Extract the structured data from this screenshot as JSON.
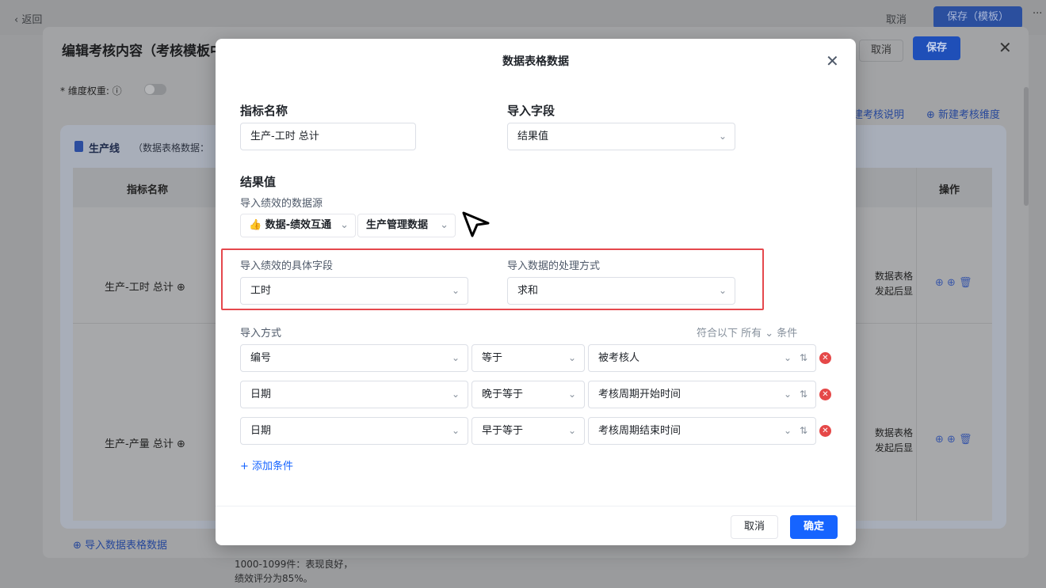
{
  "app": {
    "back": "‹ 返回",
    "top_cancel": "取消",
    "top_save": "保存（模板）",
    "more": "···"
  },
  "editor": {
    "title": "编辑考核内容（考核模板中",
    "cancel": "取消",
    "save": "保存",
    "close": "✕",
    "weight_label": "* 维度权重: ⓘ",
    "link_desc": "建考核说明",
    "link_new_dimension": "⊕ 新建考核维度",
    "section_name": "生产线",
    "section_sub": "（数据表格数据：",
    "col_indicator": "指标名称",
    "col_ops": "操作",
    "rows": [
      {
        "name": "生产-工时 总计 ⊕",
        "cell": [
          "数据表格",
          "发起后显"
        ]
      },
      {
        "name": "生产-产量 总计 ⊕",
        "cell": [
          "数据表格",
          "发起后显"
        ]
      }
    ],
    "import_link": "⊕ 导入数据表格数据",
    "below_text": [
      "1000-1099件：表现良好，",
      "绩效评分为85%。"
    ]
  },
  "modal": {
    "title": "数据表格数据",
    "close": "✕",
    "indicator_label": "指标名称",
    "indicator_value": "生产-工时 总计",
    "import_field_label": "导入字段",
    "import_field_value": "结果值",
    "result_label": "结果值",
    "source_label": "导入绩效的数据源",
    "source_chip1": "👍 数据-绩效互通",
    "source_chip2": "生产管理数据",
    "specific_field_label": "导入绩效的具体字段",
    "specific_field_value": "工时",
    "processing_label": "导入数据的处理方式",
    "processing_value": "求和",
    "import_method_label": "导入方式",
    "match_text": "符合以下 所有 ⌄ 条件",
    "conditions": [
      {
        "field": "编号",
        "op": "等于",
        "value": "被考核人"
      },
      {
        "field": "日期",
        "op": "晚于等于",
        "value": "考核周期开始时间"
      },
      {
        "field": "日期",
        "op": "早于等于",
        "value": "考核周期结束时间"
      }
    ],
    "add_condition": "+ 添加条件",
    "cancel": "取消",
    "ok": "确定"
  },
  "colors": {
    "primary": "#1664ff",
    "danger": "#e54848",
    "highlight": "#e5484d"
  }
}
